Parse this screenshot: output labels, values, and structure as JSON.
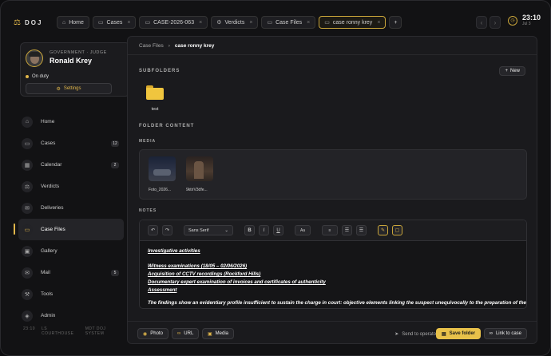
{
  "app": {
    "logo_text": "DOJ",
    "logo_icon": "scales-icon"
  },
  "tabs": [
    {
      "label": "Home",
      "icon": "home-icon"
    },
    {
      "label": "Cases",
      "icon": "folder-icon"
    },
    {
      "label": "CASE-2026-063",
      "icon": "folder-icon"
    },
    {
      "label": "Verdicts",
      "icon": "gear-icon"
    },
    {
      "label": "Case Files",
      "icon": "folder-icon"
    },
    {
      "label": "case ronny krey",
      "icon": "folder-icon"
    }
  ],
  "clock": {
    "time": "23:10",
    "date": "Jul 3"
  },
  "profile": {
    "role": "GOVERNMENT · JUDGE",
    "name": "Ronald Krey",
    "status": "On duty",
    "settings_label": "Settings"
  },
  "nav": [
    {
      "label": "Home",
      "icon": "home-icon",
      "badge": ""
    },
    {
      "label": "Cases",
      "icon": "folder-icon",
      "badge": "12"
    },
    {
      "label": "Calendar",
      "icon": "calendar-icon",
      "badge": "2"
    },
    {
      "label": "Verdicts",
      "icon": "scales-icon",
      "badge": ""
    },
    {
      "label": "Deliveries",
      "icon": "inbox-icon",
      "badge": ""
    },
    {
      "label": "Case Files",
      "icon": "folder-icon",
      "badge": ""
    },
    {
      "label": "Gallery",
      "icon": "image-icon",
      "badge": ""
    },
    {
      "label": "Mail",
      "icon": "mail-icon",
      "badge": "5"
    },
    {
      "label": "Tools",
      "icon": "wrench-icon",
      "badge": ""
    },
    {
      "label": "Admin",
      "icon": "shield-icon",
      "badge": ""
    }
  ],
  "footer": {
    "time": "23:10",
    "place": "LS COURTHOUSE",
    "system": "MDT DOJ SYSTEM"
  },
  "breadcrumb": {
    "parent": "Case Files",
    "current": "case ronny krey"
  },
  "subfolders": {
    "title": "SUBFOLDERS",
    "new_label": "New",
    "items": [
      {
        "label": "test"
      }
    ]
  },
  "content": {
    "title": "FOLDER CONTENT"
  },
  "media": {
    "title": "MEDIA",
    "items": [
      {
        "label": "Foto_2026..."
      },
      {
        "label": "9ktirV3dfe..."
      }
    ]
  },
  "notes": {
    "title": "NOTES",
    "font": "Sans Serif",
    "size_label": "Aa",
    "lines": [
      "Investigative activities",
      "Witness examinations (18/05 – 02/06/2026)",
      "Acquisition of CCTV recordings (Rockford Hills)",
      "Documentary expert examination of invoices and certificates of authenticity",
      "Assessment"
    ],
    "paragraph": "The findings show an evidentiary profile insufficient to sustain the charge in court: objective elements linking the suspect unequivocally to the preparation of the"
  },
  "actions": {
    "photo": "Photo",
    "url": "URL",
    "media": "Media",
    "send": "Send to operator",
    "save": "Save folder",
    "link": "Link to case"
  }
}
